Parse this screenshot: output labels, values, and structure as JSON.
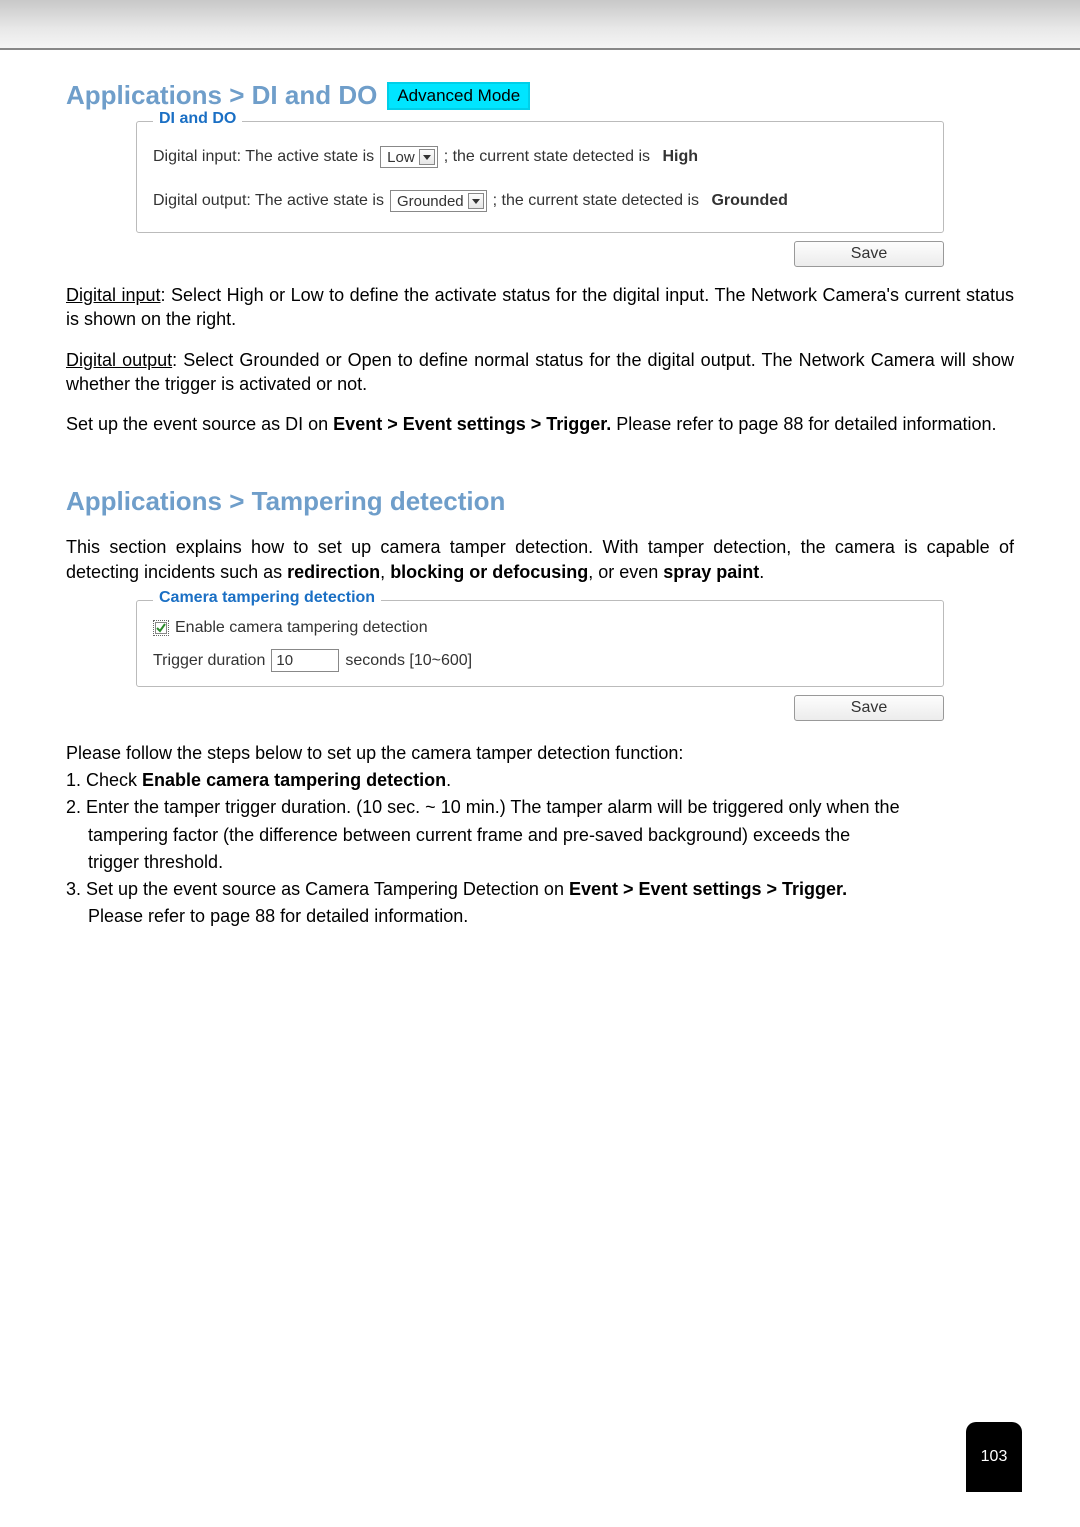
{
  "section1": {
    "heading": "Applications > DI and DO",
    "badge": "Advanced Mode",
    "fieldset_title": "DI and DO",
    "di_prefix": "Digital input: The active state is",
    "di_select": "Low",
    "di_suffix": "; the current state detected is",
    "di_state": "High",
    "do_prefix": "Digital output: The active state is",
    "do_select": "Grounded",
    "do_suffix": "; the current state detected is",
    "do_state": "Grounded",
    "save_label": "Save",
    "para1_a": "Digital input",
    "para1_b": ": Select High or Low to define the activate status for the digital input. The Network Camera's current status is shown on the right.",
    "para2_a": "Digital output",
    "para2_b": ": Select Grounded or Open to define normal status for the digital output. The Network Camera will show whether the trigger is activated or not.",
    "para3_a": "Set up the event source as DI on ",
    "para3_b": "Event > Event settings > Trigger.",
    "para3_c": " Please refer to page 88 for detailed information."
  },
  "section2": {
    "heading": "Applications > Tampering detection",
    "intro_a": "This section explains how to set up camera tamper detection. With tamper detection, the camera is capable of detecting incidents such as ",
    "intro_b": "redirection",
    "intro_c": ", ",
    "intro_d": "blocking or defocusing",
    "intro_e": ", or even ",
    "intro_f": "spray paint",
    "intro_g": ".",
    "fieldset_title": "Camera tampering detection",
    "checkbox_label": "Enable camera tampering detection",
    "duration_label": "Trigger duration",
    "duration_value": "10",
    "duration_suffix": "seconds [10~600]",
    "save_label": "Save",
    "steps_intro": "Please follow the steps below to set up the camera tamper detection function:",
    "step1_a": "1. Check ",
    "step1_b": "Enable camera tampering detection",
    "step1_c": ".",
    "step2_a": "2. Enter the tamper trigger duration. (10 sec. ~ 10 min.) The tamper alarm will be triggered only when the",
    "step2_b": "tampering factor (the difference between current frame and pre-saved background) exceeds the",
    "step2_c": "trigger threshold.",
    "step3_a": "3. Set up the event source as Camera Tampering Detection on ",
    "step3_b": "Event > Event settings > Trigger.",
    "step3_c": "Please refer to page 88 for detailed information."
  },
  "page_number": "103"
}
